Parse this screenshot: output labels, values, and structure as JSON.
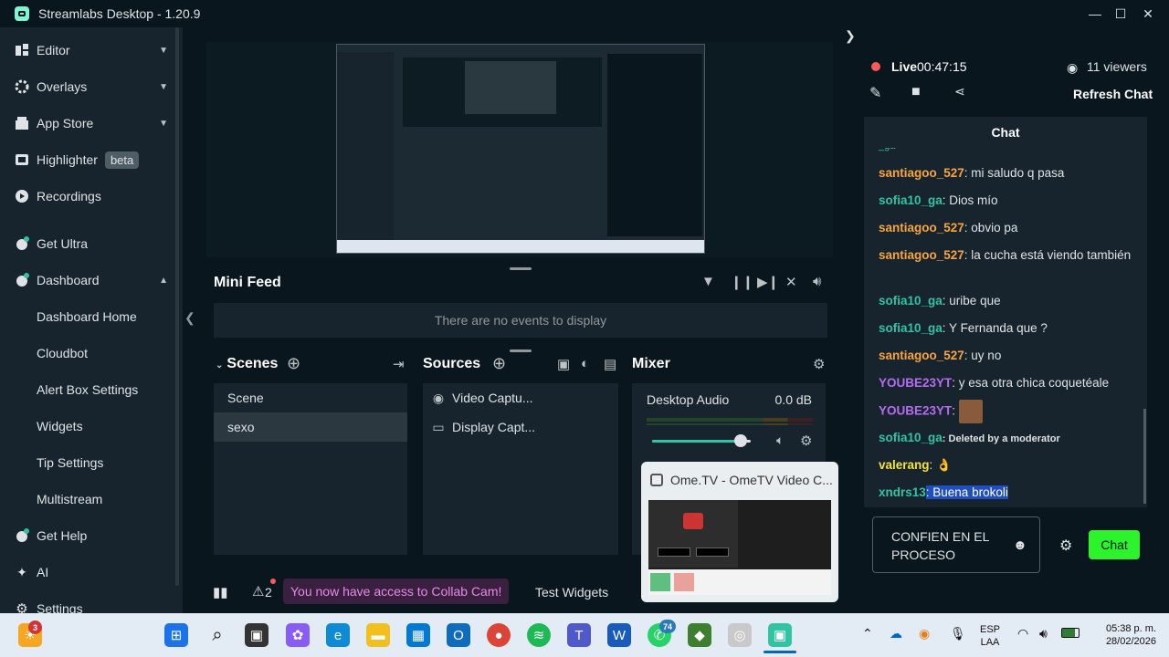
{
  "window": {
    "title": "Streamlabs Desktop - 1.20.9",
    "minimize": "—",
    "maximize": "☐",
    "close": "✕"
  },
  "sidebar": {
    "items": [
      {
        "label": "Editor"
      },
      {
        "label": "Overlays"
      },
      {
        "label": "App Store"
      },
      {
        "label": "Highlighter",
        "badge": "beta"
      },
      {
        "label": "Recordings"
      },
      {
        "label": "Get Ultra"
      },
      {
        "label": "Dashboard"
      },
      {
        "label": "Dashboard Home"
      },
      {
        "label": "Cloudbot"
      },
      {
        "label": "Alert Box Settings"
      },
      {
        "label": "Widgets"
      },
      {
        "label": "Tip Settings"
      },
      {
        "label": "Multistream"
      },
      {
        "label": "Get Help"
      },
      {
        "label": "AI"
      },
      {
        "label": "Settings"
      }
    ]
  },
  "minifeed": {
    "title": "Mini Feed",
    "empty_text": "There are no events to display"
  },
  "scenes": {
    "title": "Scenes",
    "items": [
      "Scene",
      "sexo"
    ]
  },
  "sources": {
    "title": "Sources",
    "items": [
      "Video Captu...",
      "Display Capt..."
    ]
  },
  "mixer": {
    "title": "Mixer",
    "device": "Desktop Audio",
    "level": "0.0 dB",
    "volume_fraction": 0.9
  },
  "bottom": {
    "alerts_count": "2",
    "collab_text": "You now have access to Collab Cam!",
    "test_widgets": "Test Widgets"
  },
  "popup": {
    "title": "Ome.TV - OmeTV Video C..."
  },
  "live": {
    "label": "Live",
    "time": "00:47:15",
    "viewers": "11 viewers",
    "refresh": "Refresh Chat"
  },
  "chat": {
    "title": "Chat",
    "messages": [
      {
        "user": "santiagoo_527",
        "color": "#f7a443",
        "text": ": mi saludo q pasa"
      },
      {
        "user": "sofia10_ga",
        "color": "#31c3a2",
        "text": ": Dios mío"
      },
      {
        "user": "santiagoo_527",
        "color": "#f7a443",
        "text": ": obvio pa"
      },
      {
        "user": "santiagoo_527",
        "color": "#f7a443",
        "text": ": la cucha está viendo también"
      },
      {
        "user": "sofia10_ga",
        "color": "#31c3a2",
        "text": ": uribe que"
      },
      {
        "user": "sofia10_ga",
        "color": "#31c3a2",
        "text": ": Y Fernanda que ?"
      },
      {
        "user": "santiagoo_527",
        "color": "#f7a443",
        "text": ": uy no"
      },
      {
        "user": "YOUBE23YT",
        "color": "#b56cf0",
        "text": ": y esa otra chica coquetéale"
      },
      {
        "user": "YOUBE23YT",
        "color": "#b56cf0",
        "text": ":"
      },
      {
        "user": "sofia10_ga",
        "color": "#31c3a2",
        "text": ": Deleted by a moderator"
      },
      {
        "user": "valerang",
        "color": "#f3e43a",
        "text": ": 👌"
      },
      {
        "user": "xndrs13",
        "color": "#31c3a2",
        "text": ": Buena brokoli"
      }
    ],
    "input_value": "CONFIEN EN EL PROCESO",
    "send_label": "Chat"
  },
  "taskbar": {
    "notification_count": "3",
    "whatsapp_count": "74",
    "lang_top": "ESP",
    "lang_bottom": "LAA",
    "time": "05:38 p. m.",
    "date": "28/02/2026"
  },
  "colors": {
    "accent": "#31c3a2",
    "chat_button": "#2df32d",
    "live": "#f85959"
  }
}
